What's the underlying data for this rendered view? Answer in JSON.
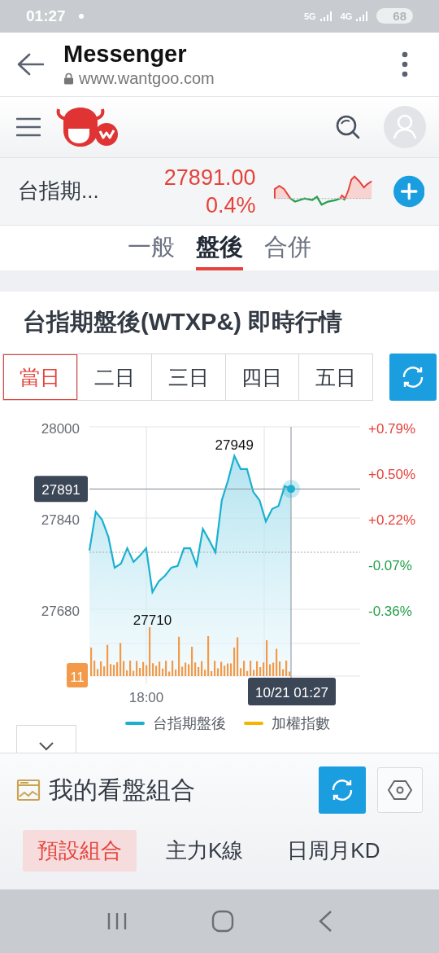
{
  "status_bar": {
    "time": "01:27",
    "networks": [
      "5G",
      "4G"
    ],
    "battery": "68"
  },
  "browser": {
    "title": "Messenger",
    "url": "www.wantgoo.com"
  },
  "ticker": {
    "name": "台指期...",
    "price": "27891.00",
    "change": "0.4%"
  },
  "market_tabs": [
    {
      "label": "一般",
      "selected": false
    },
    {
      "label": "盤後",
      "selected": true
    },
    {
      "label": "合併",
      "selected": false
    }
  ],
  "quote_card": {
    "title": "台指期盤後(WTXP&) 即時行情",
    "periods": [
      {
        "label": "當日",
        "selected": true
      },
      {
        "label": "二日",
        "selected": false
      },
      {
        "label": "三日",
        "selected": false
      },
      {
        "label": "四日",
        "selected": false
      },
      {
        "label": "五日",
        "selected": false
      }
    ],
    "chart": {
      "chart_data": {
        "type": "area",
        "series": [
          {
            "name": "台指期盤後",
            "color": "#1bb0d0",
            "values": [
              27783,
              27851,
              27837,
              27807,
              27753,
              27760,
              27787,
              27763,
              27774,
              27787,
              27710,
              27729,
              27739,
              27753,
              27756,
              27787,
              27787,
              27757,
              27821,
              27801,
              27780,
              27871,
              27906,
              27949,
              27926,
              27926,
              27886,
              27871,
              27834,
              27856,
              27861,
              27896,
              27891
            ]
          }
        ],
        "ylim": [
          27680,
          28000
        ],
        "yticks": [
          27680,
          27840,
          28000
        ],
        "ref_lines": [
          {
            "axis": "y",
            "value": 27780
          },
          {
            "axis": "y",
            "value": 27891,
            "label": "27891"
          }
        ],
        "annotations": [
          "27949",
          "27710"
        ]
      },
      "x_axis_labels": [
        "18:00"
      ],
      "right_axis_labels": [
        {
          "label": "+0.79%",
          "color": "#e5423a"
        },
        {
          "label": "+0.50%",
          "color": "#e5423a"
        },
        {
          "label": "+0.22%",
          "color": "#e5423a"
        },
        {
          "label": "-0.07%",
          "color": "#23a04a"
        },
        {
          "label": "-0.36%",
          "color": "#23a04a"
        }
      ],
      "volume_label": "11",
      "cursor_label": "10/21 01:27",
      "other_legend": [
        {
          "label": "加權指數",
          "color": "#f5b400"
        }
      ]
    }
  },
  "watchlist": {
    "title": "我的看盤組合",
    "tabs": [
      {
        "label": "預設組合",
        "selected": true
      },
      {
        "label": "主力K線",
        "selected": false
      },
      {
        "label": "日周月KD",
        "selected": false
      }
    ]
  }
}
